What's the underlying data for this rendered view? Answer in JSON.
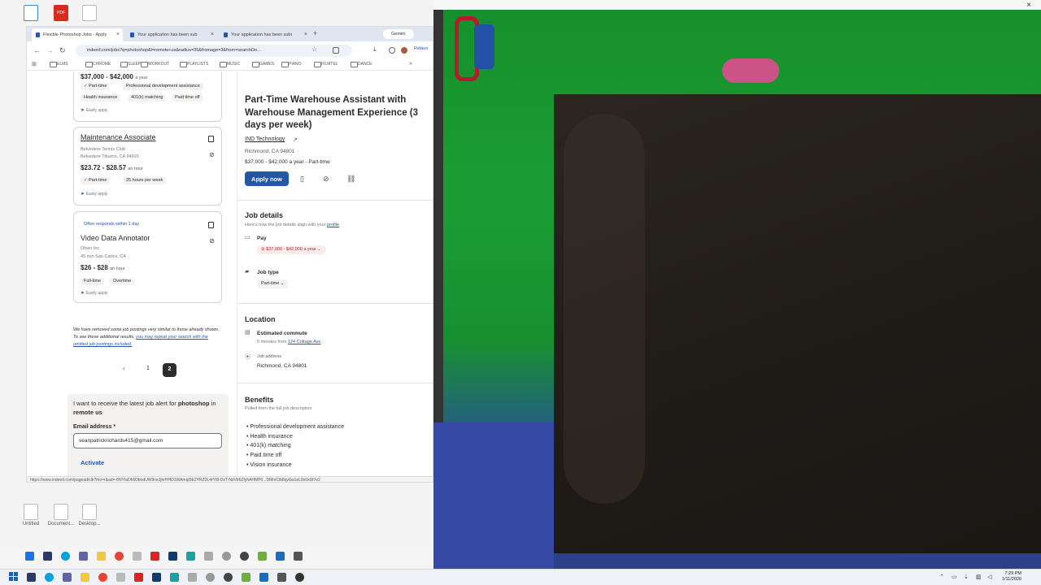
{
  "desktop": {
    "icons_top": [
      "",
      "PDF",
      ""
    ],
    "icons_bottom": [
      "Untitled",
      "Document...",
      "Desktop..."
    ]
  },
  "browser": {
    "tabs": [
      {
        "label": "Flexible Photoshop Jobs - Apply",
        "active": true
      },
      {
        "label": "Your application has been sub",
        "active": false
      },
      {
        "label": "Your application has been subr",
        "active": false
      }
    ],
    "new_tab": "+",
    "gemini": "Gemini",
    "url": "indeed.com/jobs?q=photoshop&l=remote+us&radius=35&fromage=3&from=searchOn...",
    "profile": "Relaun",
    "bookmarks": [
      "ELMS",
      "CHROME",
      "SLEEP",
      "WORKOUT",
      "PLAYLISTS",
      "MUSIC",
      "GAMES",
      "PIANO",
      "FILMTEL",
      "DANCE"
    ],
    "status_url": "https://www.indeed.com/pagead/clk?mo=r&ad=-6NYfaDh6DbodUW9neJjhrHHD1WAmqI9E2YRZ0L4rYt8-DzT-NzVb6ZfyhAHMP0...DMmCib8qvGa1eL8x0xDt7e2"
  },
  "job_list": {
    "card0": {
      "pay": "$37,000 - $42,000",
      "pay_unit": "a year",
      "chips": [
        "Part-time",
        "Professional development assistance",
        "Health insurance",
        "401(k) matching",
        "Paid time off"
      ],
      "easy": "Easily apply"
    },
    "card1": {
      "title": "Maintenance Associate",
      "company": "Belvedere Tennis Club",
      "location": "Belvedere Tiburon, CA 94920",
      "pay": "$23.72 - $28.57",
      "pay_unit": "an hour",
      "chips": [
        "Part-time",
        "25 hours per week"
      ],
      "easy": "Easily apply"
    },
    "card2": {
      "badge": "Often responds within 1 day",
      "title": "Video Data Annotator",
      "company": "Obvio Inc",
      "location": "45 min   San Carlos, CA",
      "pay": "$26 - $28",
      "pay_unit": "an hour",
      "chips": [
        "Full-time",
        "Overtime"
      ],
      "easy": "Easily apply"
    },
    "removed_note": "We have removed some job postings very similar to those already shown. To see these additional results,",
    "removed_link": "you may repeat your search with the omitted job postings included.",
    "pagination": {
      "prev": "‹",
      "page1": "1",
      "page2": "2"
    },
    "alert": {
      "text_pre": "I want to receive the latest job alert for",
      "keyword": "photoshop",
      "text_mid": "in",
      "location": "remote us",
      "email_label": "Email address *",
      "email_value": "seanpatrickrichards415@gmail.com",
      "activate": "Activate"
    }
  },
  "job_detail": {
    "title": "Part-Time Warehouse Assistant with Warehouse Management Experience (3 days per week)",
    "company": "IND Technology",
    "location": "Richmond, CA 94801",
    "salary": "$37,000 - $42,000 a year  -  Part-time",
    "apply": "Apply now",
    "job_details_heading": "Job details",
    "job_details_sub": "Here's how the job details align with your",
    "profile_link": "profile",
    "pay_label": "Pay",
    "pay_value": "$37,000 - $42,000 a year",
    "job_type_label": "Job type",
    "job_type_value": "Part-time",
    "location_heading": "Location",
    "commute_label": "Estimated commute",
    "commute_text": "5 minutes from",
    "commute_link": "124 Cottage Ave",
    "address_label": "Job address",
    "address_value": "Richmond, CA 94801",
    "benefits_heading": "Benefits",
    "benefits_sub": "Pulled from the full job description",
    "benefits": [
      "Professional development assistance",
      "Health insurance",
      "401(k) matching",
      "Paid time off",
      "Vision insurance"
    ]
  },
  "taskbar": {
    "clock_time": "7:29 PM",
    "clock_date": "1/11/2026"
  },
  "colors": {
    "indeed_blue": "#2557a7",
    "green_screen": "#1b9d35",
    "text_dark": "#2d2d2d"
  }
}
